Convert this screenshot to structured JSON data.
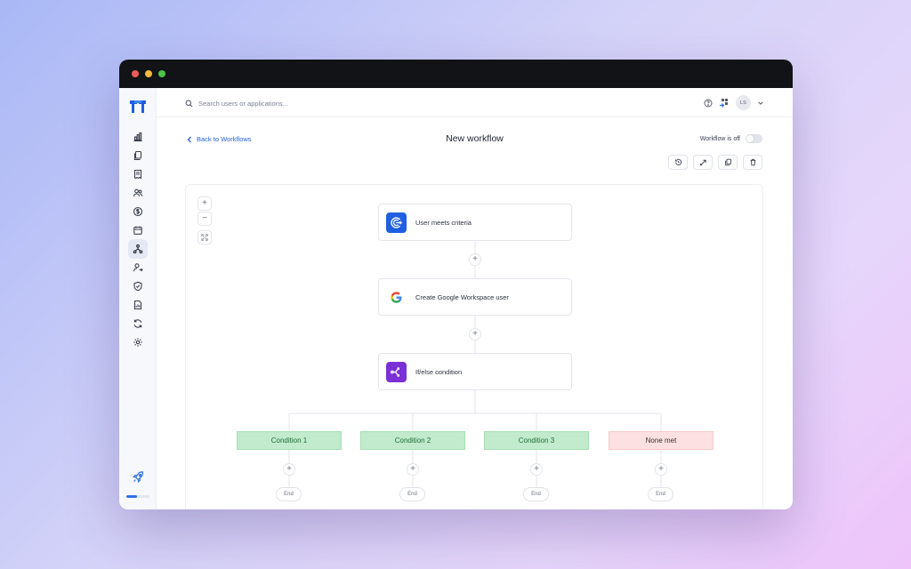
{
  "search": {
    "placeholder": "Search users or applications..."
  },
  "topbar": {
    "avatar_initials": "LS"
  },
  "header": {
    "back_label": "Back to Workflows",
    "title": "New workflow",
    "toggle_label": "Workflow is off",
    "workflow_enabled": false
  },
  "sidebar": {
    "items": [
      {
        "icon": "dashboard-icon"
      },
      {
        "icon": "applications-icon"
      },
      {
        "icon": "documents-icon"
      },
      {
        "icon": "users-icon"
      },
      {
        "icon": "spend-icon"
      },
      {
        "icon": "calendar-icon"
      },
      {
        "icon": "workflows-icon",
        "active": true
      },
      {
        "icon": "user-lifecycle-icon"
      },
      {
        "icon": "security-icon"
      },
      {
        "icon": "reports-icon"
      },
      {
        "icon": "sync-icon"
      },
      {
        "icon": "settings-icon"
      }
    ],
    "onboarding_progress": 0.45
  },
  "toolbar": {
    "tools": [
      "history-icon",
      "share-icon",
      "duplicate-icon",
      "delete-icon"
    ]
  },
  "canvas": {
    "zoom_controls": {
      "zoom_in": "+",
      "zoom_out": "−"
    },
    "nodes": [
      {
        "label": "User meets criteria",
        "icon": "trigger-icon",
        "color": "#1f5fe0"
      },
      {
        "label": "Create Google Workspace user",
        "icon": "google-icon",
        "color": "#ffffff"
      },
      {
        "label": "If/else condition",
        "icon": "branch-icon",
        "color": "#7b2fd6"
      }
    ],
    "add_step_symbol": "+",
    "branches": [
      {
        "label": "Condition 1",
        "status": "condition",
        "end_label": "End"
      },
      {
        "label": "Condition 2",
        "status": "condition",
        "end_label": "End"
      },
      {
        "label": "Condition 3",
        "status": "condition",
        "end_label": "End"
      },
      {
        "label": "None met",
        "status": "fallback",
        "end_label": "End"
      }
    ]
  },
  "colors": {
    "accent": "#2b62d7",
    "condition_bg": "#c1ebcc",
    "none_met_bg": "#fde1e2",
    "titlebar": "#111316"
  }
}
